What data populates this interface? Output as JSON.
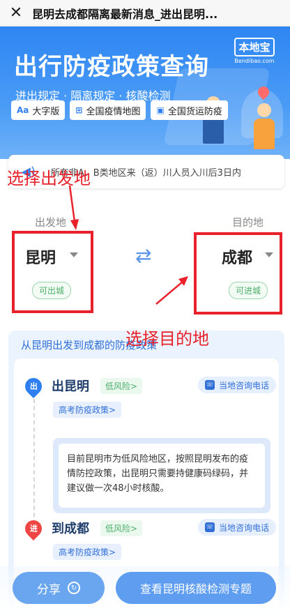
{
  "navbar": {
    "close_icon": "close-icon",
    "title": "昆明去成都隔离最新消息_进出昆明..."
  },
  "banner": {
    "title": "出行防疫政策查询",
    "subtitle": "进出规定 · 隔离规定 · 核酸检测",
    "brand": "本地宝",
    "brand_sub": "Bendibao.com",
    "chips": [
      {
        "icon": "Aa",
        "label": "大字版"
      },
      {
        "icon": "map-icon",
        "label": "全国疫情地图"
      },
      {
        "icon": "truck-icon",
        "label": "全国货运防疫"
      }
    ]
  },
  "notice": {
    "icon": "speaker-icon",
    "text": "所有非A、B类地区来（返）川人员入川后3日内"
  },
  "selector": {
    "from_label": "出发地",
    "to_label": "目的地",
    "from_city": "昆明",
    "to_city": "成都",
    "from_tag": "可出城",
    "to_tag": "可进城",
    "swap_icon": "swap-icon"
  },
  "policy": {
    "header": "从昆明出发到成都的防疫政策",
    "out": {
      "badge": "出",
      "title": "出昆明",
      "risk": "低风险>",
      "consult": "当地咨询电话",
      "exam": "高考防疫政策>",
      "info": "目前昆明市为低风险地区，按照昆明发布的疫情防控政策，出昆明只需要持健康码绿码，并建议做一次48小时核酸。"
    },
    "in": {
      "badge": "进",
      "title": "到成都",
      "risk": "低风险>",
      "consult": "当地咨询电话",
      "exam": "高考防疫政策>"
    }
  },
  "buttons": {
    "share": "分享",
    "main": "查看昆明核酸检测专题"
  },
  "annotations": {
    "from_hint": "选择出发地",
    "to_hint": "选择目的地"
  },
  "colors": {
    "primary": "#2f7ff0",
    "annotation": "#e8212b",
    "low_risk": "#4caf6a"
  }
}
